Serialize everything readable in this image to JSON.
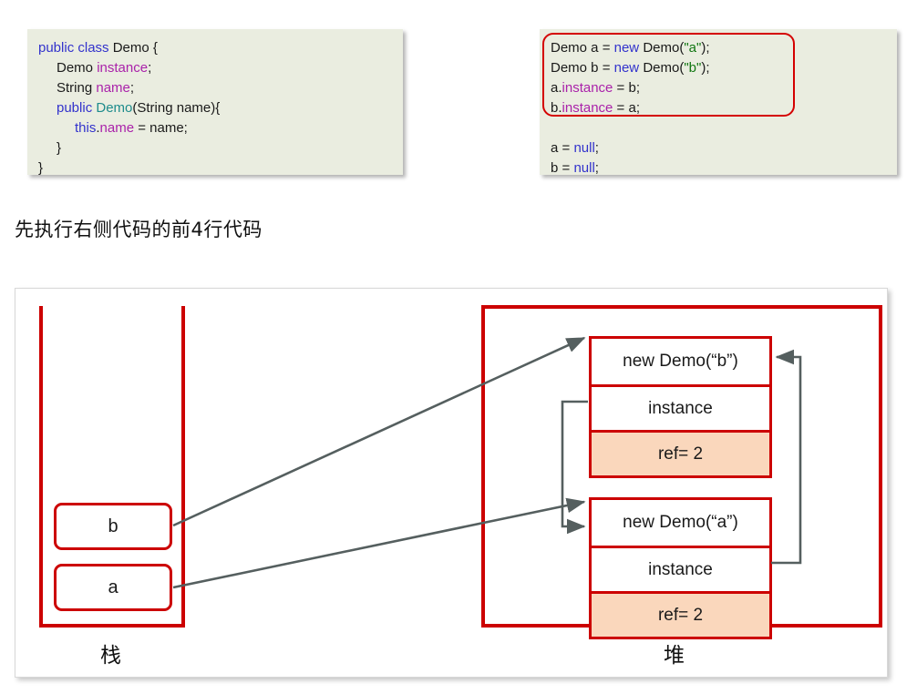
{
  "code_left": {
    "name": "Demo class definition",
    "lines": [
      [
        {
          "t": "public class ",
          "c": "kw"
        },
        {
          "t": "Demo {",
          "c": "plain"
        }
      ],
      [
        {
          "t": "Demo ",
          "c": "plain"
        },
        {
          "t": "instance",
          "c": "fld"
        },
        {
          "t": ";",
          "c": "plain"
        }
      ],
      [
        {
          "t": "String ",
          "c": "plain"
        },
        {
          "t": "name",
          "c": "fld"
        },
        {
          "t": ";",
          "c": "plain"
        }
      ],
      [
        {
          "t": "public ",
          "c": "kw"
        },
        {
          "t": "Demo",
          "c": "typ"
        },
        {
          "t": "(String name){",
          "c": "plain"
        }
      ],
      [
        {
          "t": "this",
          "c": "kw"
        },
        {
          "t": ".",
          "c": "plain"
        },
        {
          "t": "name",
          "c": "fld"
        },
        {
          "t": " = name;",
          "c": "plain"
        }
      ],
      [
        {
          "t": "}",
          "c": "plain"
        }
      ],
      [
        {
          "t": "}",
          "c": "plain"
        }
      ]
    ],
    "indents": [
      0,
      1,
      1,
      1,
      2,
      1,
      0
    ]
  },
  "code_right": {
    "name": "main method statements",
    "lines": [
      [
        {
          "t": "Demo a = ",
          "c": "plain"
        },
        {
          "t": "new ",
          "c": "kw"
        },
        {
          "t": "Demo(",
          "c": "plain"
        },
        {
          "t": "\"a\"",
          "c": "str"
        },
        {
          "t": ");",
          "c": "plain"
        }
      ],
      [
        {
          "t": "Demo b = ",
          "c": "plain"
        },
        {
          "t": "new ",
          "c": "kw"
        },
        {
          "t": "Demo(",
          "c": "plain"
        },
        {
          "t": "\"b\"",
          "c": "str"
        },
        {
          "t": ");",
          "c": "plain"
        }
      ],
      [
        {
          "t": "a.",
          "c": "plain"
        },
        {
          "t": "instance",
          "c": "fld"
        },
        {
          "t": " = b;",
          "c": "plain"
        }
      ],
      [
        {
          "t": "b.",
          "c": "plain"
        },
        {
          "t": "instance",
          "c": "fld"
        },
        {
          "t": " = a;",
          "c": "plain"
        }
      ],
      [
        {
          "t": " ",
          "c": "plain"
        }
      ],
      [
        {
          "t": "a = ",
          "c": "plain"
        },
        {
          "t": "null",
          "c": "kw"
        },
        {
          "t": ";",
          "c": "plain"
        }
      ],
      [
        {
          "t": "b = ",
          "c": "plain"
        },
        {
          "t": "null",
          "c": "kw"
        },
        {
          "t": ";",
          "c": "plain"
        }
      ]
    ],
    "indents": [
      0,
      0,
      0,
      0,
      0,
      0,
      0
    ],
    "highlight_note": "first 4 lines outlined in red"
  },
  "caption": "先执行右侧代码的前4行代码",
  "diagram": {
    "stack": {
      "label": "栈",
      "variables": [
        {
          "name": "b"
        },
        {
          "name": "a"
        }
      ]
    },
    "heap": {
      "label": "堆",
      "objects": [
        {
          "title": "new Demo(“b”)",
          "field": "instance",
          "refcount": "ref= 2"
        },
        {
          "title": "new Demo(“a”)",
          "field": "instance",
          "refcount": "ref= 2"
        }
      ]
    },
    "arrows": [
      {
        "from": "stack-var-b",
        "to": "heap-object-b"
      },
      {
        "from": "stack-var-a",
        "to": "heap-object-a"
      },
      {
        "from": "heap-object-b.instance",
        "to": "heap-object-a"
      },
      {
        "from": "heap-object-a.instance",
        "to": "heap-object-b"
      }
    ]
  },
  "colors": {
    "red_border": "#CC0000",
    "highlight_red": "#D40000",
    "refcount_fill": "#FAD7BC",
    "code_bg": "#EAEDE0",
    "arrow_gray": "#555F5F",
    "keyword_blue": "#3333CC",
    "field_purple": "#AA22AA",
    "type_teal": "#1E8C8C",
    "string_green": "#117711"
  }
}
